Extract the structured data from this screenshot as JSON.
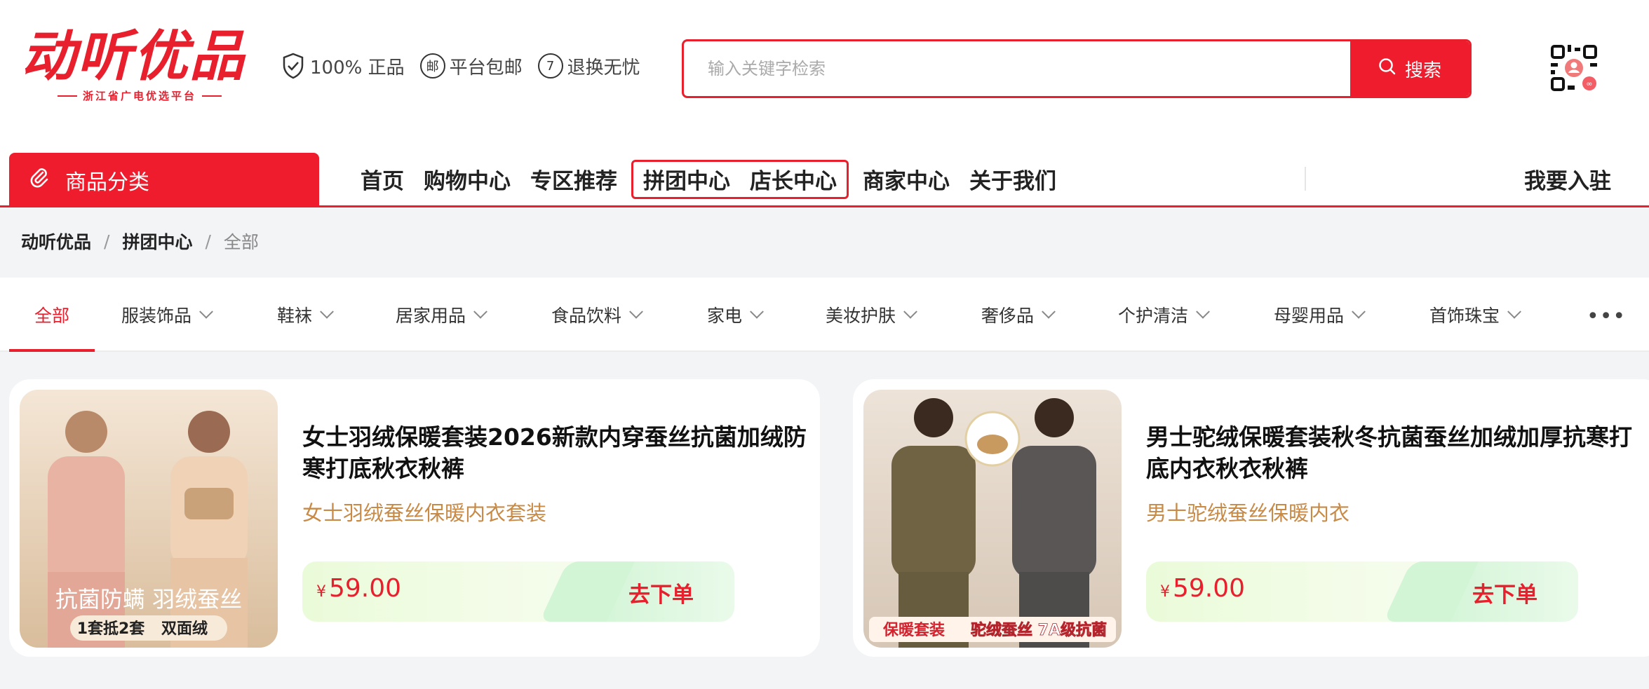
{
  "logo": {
    "main": "动听优品",
    "sub": "浙江省广电优选平台"
  },
  "badges": [
    {
      "icon": "shield-check-icon",
      "label": "100% 正品"
    },
    {
      "icon": "mail-circle-icon",
      "glyph": "邮",
      "label": "平台包邮"
    },
    {
      "icon": "seven-circle-icon",
      "glyph": "7",
      "label": "退换无忧"
    }
  ],
  "search": {
    "placeholder": "输入关键字检索",
    "button_label": "搜索"
  },
  "nav": {
    "category_label": "商品分类",
    "links": [
      "首页",
      "购物中心",
      "专区推荐"
    ],
    "boxed_links": [
      "拼团中心",
      "店长中心"
    ],
    "links_after": [
      "商家中心",
      "关于我们"
    ],
    "join_label": "我要入驻"
  },
  "breadcrumb": {
    "items": [
      "动听优品",
      "拼团中心"
    ],
    "separator": "/",
    "current": "全部"
  },
  "categories": {
    "active": "全部",
    "tabs": [
      "服装饰品",
      "鞋袜",
      "居家用品",
      "食品饮料",
      "家电",
      "美妆护肤",
      "奢侈品",
      "个护清洁",
      "母婴用品",
      "首饰珠宝"
    ],
    "more_icon": "more-dots-icon"
  },
  "products": [
    {
      "title": "女士羽绒保暖套装2026新款内穿蚕丝抗菌加绒防寒打底秋衣秋裤",
      "subtitle": "女士羽绒蚕丝保暖内衣套装",
      "currency": "¥",
      "price": "59.00",
      "order_label": "去下单",
      "image_text": {
        "line1": "抗菌防螨 羽绒蚕丝",
        "tag1": "1套抵2套",
        "tag2": "双面绒"
      }
    },
    {
      "title": "男士驼绒保暖套装秋冬抗菌蚕丝加绒加厚抗寒打底内衣秋衣秋裤",
      "subtitle": "男士驼绒蚕丝保暖内衣",
      "currency": "¥",
      "price": "59.00",
      "order_label": "去下单",
      "image_text": {
        "tag1": "保暖套装",
        "tag2": "驼绒蚕丝 7A级抗菌"
      }
    }
  ],
  "colors": {
    "accent": "#e8202e",
    "subtitle": "#c78a47"
  }
}
